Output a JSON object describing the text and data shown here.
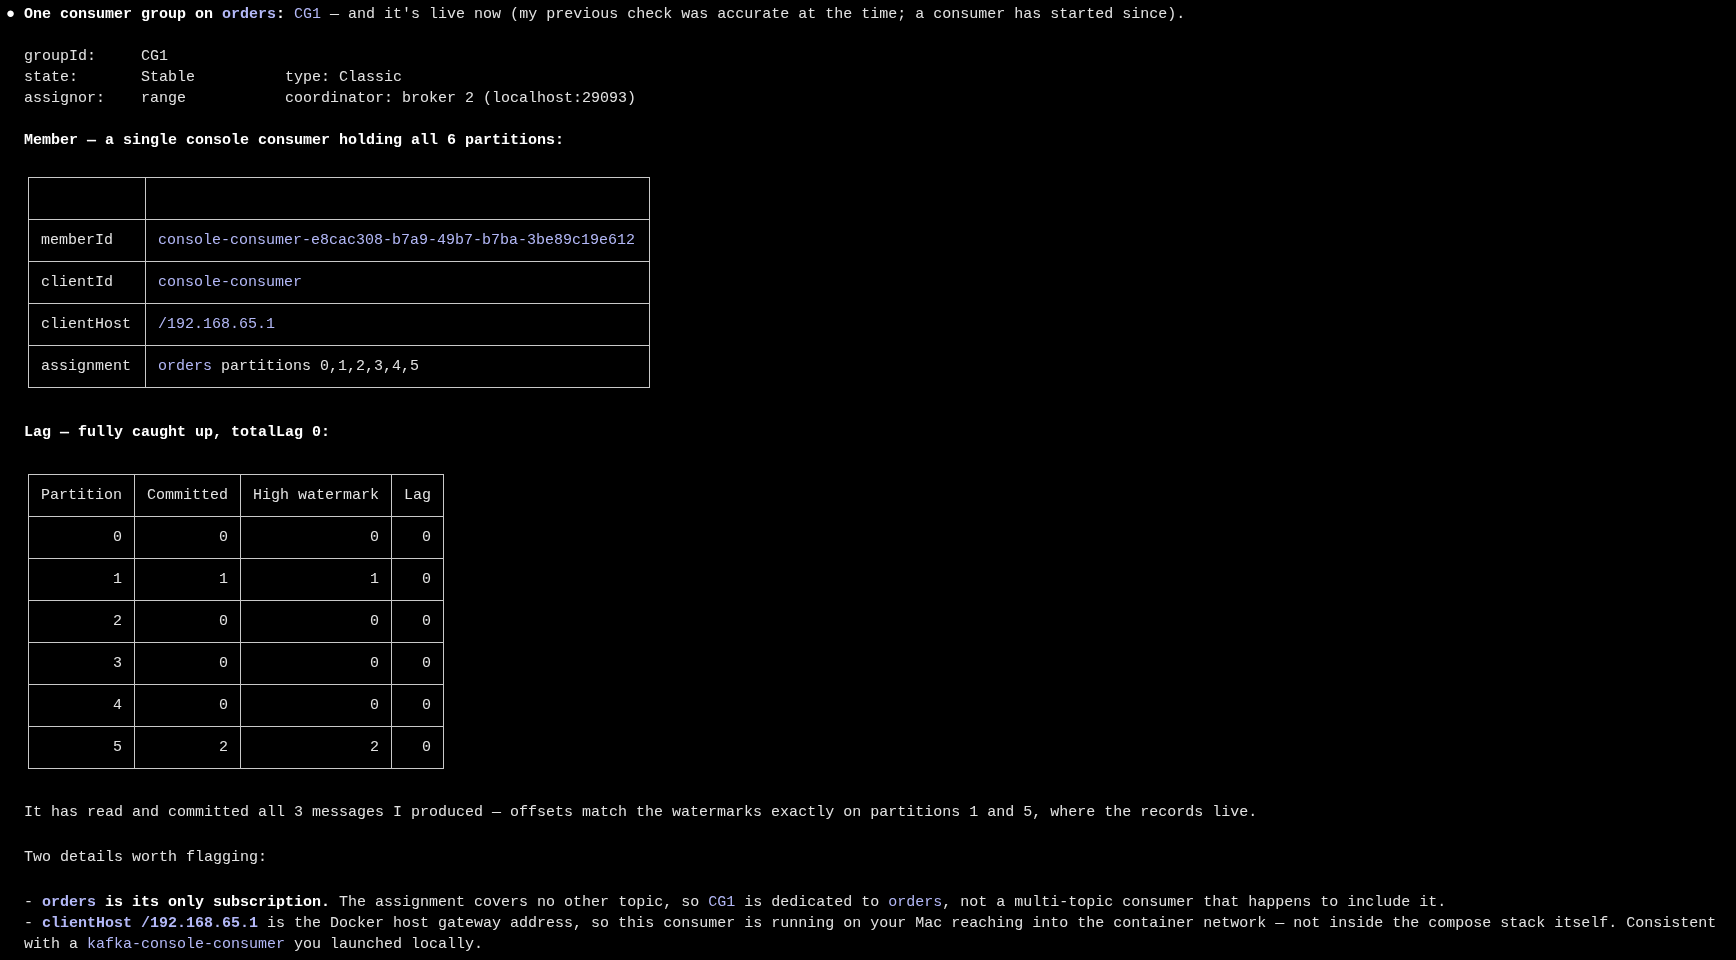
{
  "marker": "●",
  "headline": [
    {
      "text": "One consumer group on ",
      "kind": "bold"
    },
    {
      "text": "orders",
      "kind": "boldcode"
    },
    {
      "text": ": ",
      "kind": "bold"
    },
    {
      "text": "CG1",
      "kind": "code"
    },
    {
      "text": " — and it's live now (my previous check was accurate at the time; a consumer has started since).",
      "kind": "text"
    }
  ],
  "fields": [
    {
      "label": "groupId:",
      "value": "CG1"
    },
    {
      "label": "state:",
      "value": "Stable",
      "extra": "type: Classic"
    },
    {
      "label": "assignor:",
      "value": "range",
      "extra": "coordinator: broker 2 (localhost:29093)"
    }
  ],
  "member_heading": "Member — a single console consumer holding all 6 partitions:",
  "member_table": {
    "rows": [
      {
        "key": "memberId",
        "value": [
          {
            "text": "console-consumer-e8cac308-b7a9-49b7-b7ba-3be89c19e612",
            "kind": "code"
          }
        ]
      },
      {
        "key": "clientId",
        "value": [
          {
            "text": "console-consumer",
            "kind": "code"
          }
        ]
      },
      {
        "key": "clientHost",
        "value": [
          {
            "text": "/192.168.65.1",
            "kind": "code"
          }
        ]
      },
      {
        "key": "assignment",
        "value": [
          {
            "text": "orders",
            "kind": "code"
          },
          {
            "text": " partitions 0,1,2,3,4,5",
            "kind": "text"
          }
        ]
      }
    ]
  },
  "lag_heading": "Lag — fully caught up, totalLag 0:",
  "lag_table": {
    "columns": [
      "Partition",
      "Committed",
      "High watermark",
      "Lag"
    ],
    "rows": [
      [
        "0",
        "0",
        "0",
        "0"
      ],
      [
        "1",
        "1",
        "1",
        "0"
      ],
      [
        "2",
        "0",
        "0",
        "0"
      ],
      [
        "3",
        "0",
        "0",
        "0"
      ],
      [
        "4",
        "0",
        "0",
        "0"
      ],
      [
        "5",
        "2",
        "2",
        "0"
      ]
    ]
  },
  "summary": "It has read and committed all 3 messages I produced — offsets match the watermarks exactly on partitions 1 and 5, where the records live.",
  "details_heading": "Two details worth flagging:",
  "details": [
    [
      {
        "text": "- ",
        "kind": "text"
      },
      {
        "text": "orders",
        "kind": "boldcode"
      },
      {
        "text": " is its only subscription.",
        "kind": "bold"
      },
      {
        "text": " The assignment covers no other topic, so ",
        "kind": "text"
      },
      {
        "text": "CG1",
        "kind": "code"
      },
      {
        "text": " is dedicated to ",
        "kind": "text"
      },
      {
        "text": "orders",
        "kind": "code"
      },
      {
        "text": ", not a multi-topic consumer that happens to include it.",
        "kind": "text"
      }
    ],
    [
      {
        "text": "- ",
        "kind": "text"
      },
      {
        "text": "clientHost /192.168.65.1",
        "kind": "boldcode"
      },
      {
        "text": " is the Docker host gateway address, so this consumer is running on your Mac reaching into the container network — not inside the compose stack itself. Consistent with a ",
        "kind": "text"
      },
      {
        "text": "kafka-console-consumer",
        "kind": "code"
      },
      {
        "text": " you launched locally.",
        "kind": "text"
      }
    ]
  ]
}
